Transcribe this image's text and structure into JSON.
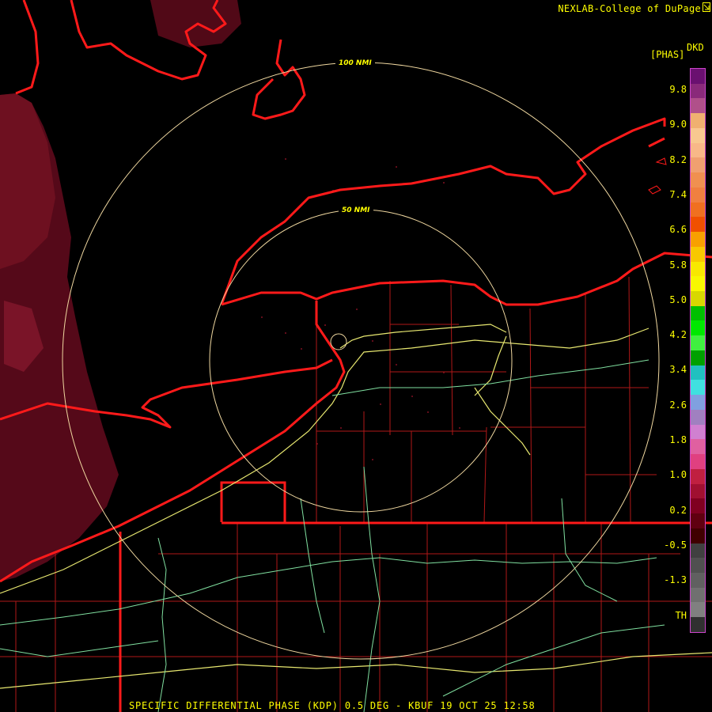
{
  "header": {
    "credit": "NEXLAB-College of DuPage"
  },
  "footer": {
    "product_line": "SPECIFIC DIFFERENTIAL PHASE (KDP) 0.5 DEG - KBUF 19 OCT 25 12:58"
  },
  "range_rings": [
    {
      "label": "100 NMI"
    },
    {
      "label": "50 NMI"
    }
  ],
  "legend": {
    "product": "DKD",
    "units": "[PHAS]",
    "ticks": [
      "9.8",
      "9.0",
      "8.2",
      "7.4",
      "6.6",
      "5.8",
      "5.0",
      "4.2",
      "3.4",
      "2.6",
      "1.8",
      "1.0",
      "0.2",
      "-0.5",
      "-1.3",
      "TH"
    ],
    "colors": [
      "#6a1070",
      "#8a2a7a",
      "#b0508a",
      "#f0b070",
      "#f8c890",
      "#f8b888",
      "#f0a070",
      "#f09050",
      "#f08040",
      "#f07020",
      "#f05000",
      "#f8a000",
      "#f8c800",
      "#f8e800",
      "#f8f800",
      "#d8d800",
      "#00c000",
      "#00e800",
      "#40f040",
      "#00a000",
      "#20c0c0",
      "#40e0e0",
      "#80a0e0",
      "#a080c0",
      "#d080d0",
      "#e060a0",
      "#e04080",
      "#c02040",
      "#a01030",
      "#800020",
      "#600010",
      "#400000",
      "#404040",
      "#505050",
      "#606060",
      "#707070",
      "#808080",
      "#303030"
    ],
    "outline_color": "#cc44cc"
  },
  "colors": {
    "background": "#000000",
    "coastline": "#ff1a1a",
    "county_lines": "#b01818",
    "highways_yellow": "#e8e870",
    "highways_green": "#80e0a0",
    "range_ring": "#f0d8a0",
    "echo_dark": "#5a0a1a",
    "label_text": "#ffff00"
  }
}
